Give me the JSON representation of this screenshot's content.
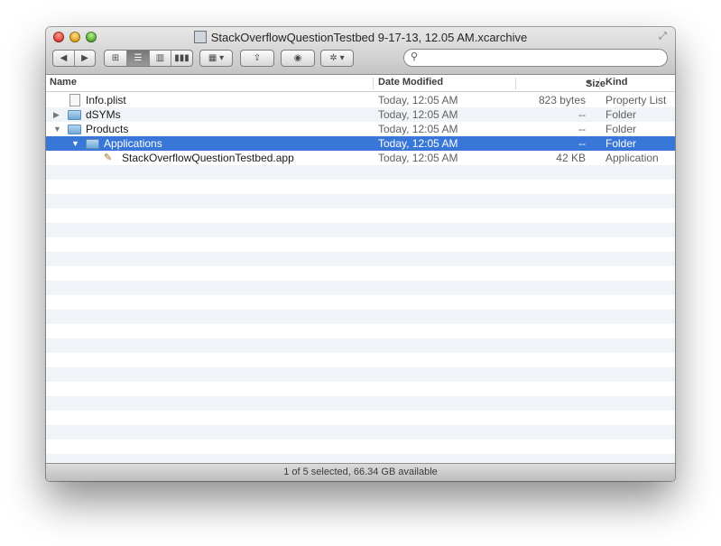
{
  "window": {
    "title": "StackOverflowQuestionTestbed 9-17-13, 12.05 AM.xcarchive"
  },
  "toolbar": {
    "nav": [
      "◀",
      "▶"
    ],
    "view_modes": [
      "icon-view",
      "list-view",
      "column-view",
      "coverflow-view"
    ],
    "active_view": "list-view",
    "arrange_icon": "arrange-icon",
    "share_icon": "share-icon",
    "tag_icon": "tag-icon",
    "action_icon": "gear-icon"
  },
  "search": {
    "placeholder": "",
    "value": ""
  },
  "columns": {
    "name": "Name",
    "date": "Date Modified",
    "size": "Size",
    "kind": "Kind"
  },
  "files": [
    {
      "name": "Info.plist",
      "date": "Today, 12:05 AM",
      "size": "823 bytes",
      "kind": "Property List",
      "icon": "file-icon",
      "depth": 1,
      "disclosure": ""
    },
    {
      "name": "dSYMs",
      "date": "Today, 12:05 AM",
      "size": "--",
      "kind": "Folder",
      "icon": "folder-icon",
      "depth": 1,
      "disclosure": "▶"
    },
    {
      "name": "Products",
      "date": "Today, 12:05 AM",
      "size": "--",
      "kind": "Folder",
      "icon": "folder-icon",
      "depth": 1,
      "disclosure": "▼"
    },
    {
      "name": "Applications",
      "date": "Today, 12:05 AM",
      "size": "--",
      "kind": "Folder",
      "icon": "folder-icon",
      "depth": 2,
      "disclosure": "▼",
      "selected": true
    },
    {
      "name": "StackOverflowQuestionTestbed.app",
      "date": "Today, 12:05 AM",
      "size": "42 KB",
      "kind": "Application",
      "icon": "app-icon",
      "depth": 3,
      "disclosure": ""
    }
  ],
  "status": {
    "text": "1 of 5 selected, 66.34 GB available"
  },
  "colors": {
    "selection": "#3877d7",
    "stripe": "#f0f4f9"
  }
}
